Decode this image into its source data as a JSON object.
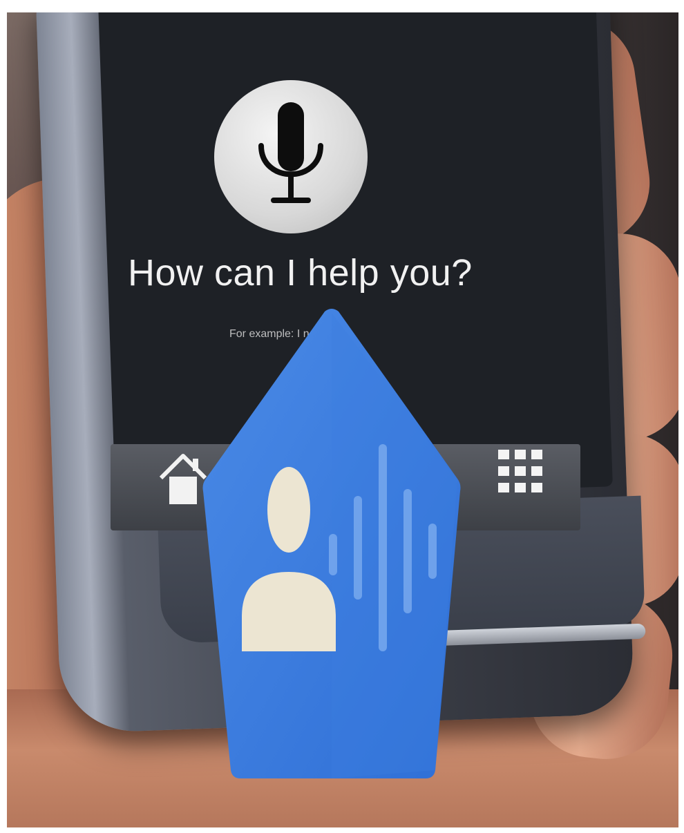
{
  "assistant_prompt": {
    "title": "How can I help you?",
    "hint_line_1": "For example: I need",
    "hint_line_2": ""
  },
  "dock": {
    "left_label": "",
    "right_label": ""
  },
  "icons": {
    "microphone": "microphone-icon",
    "home": "home-icon",
    "apps_grid": "apps-grid-icon",
    "assistant_badge": "voice-assistant-badge-icon"
  },
  "colors": {
    "badge_blue": "#3b7fe0",
    "badge_blue_light": "#5a96ea",
    "badge_figure": "#e9e2cf",
    "screen": "#1e2126"
  }
}
